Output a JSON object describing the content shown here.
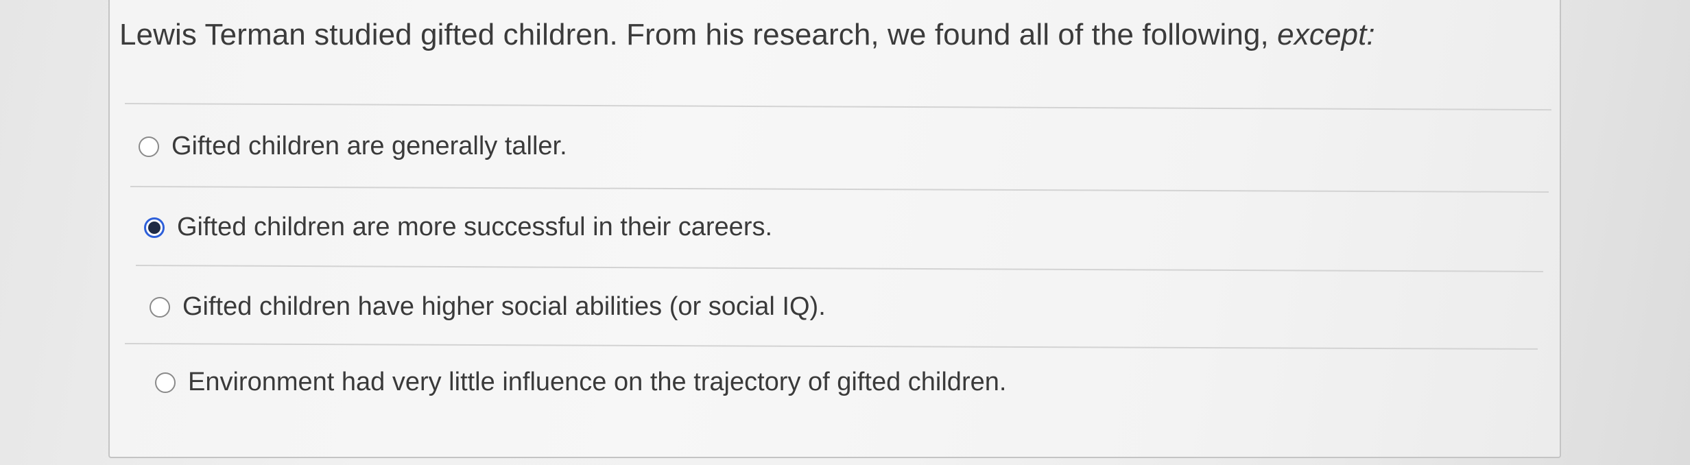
{
  "question": {
    "text_main": "Lewis Terman studied gifted children. From his research, we found all of the following, ",
    "text_emphasis": "except:"
  },
  "options": [
    {
      "label": "Gifted children are generally taller.",
      "selected": false
    },
    {
      "label": "Gifted children are more successful in their careers.",
      "selected": true
    },
    {
      "label": "Gifted children have higher social abilities (or social IQ).",
      "selected": false
    },
    {
      "label": "Environment had very little influence on the trajectory of gifted children.",
      "selected": false
    }
  ],
  "colors": {
    "radio_selected_ring": "#2d5fd9",
    "radio_selected_dot": "#1f2a44",
    "text": "#3a3a3a"
  }
}
